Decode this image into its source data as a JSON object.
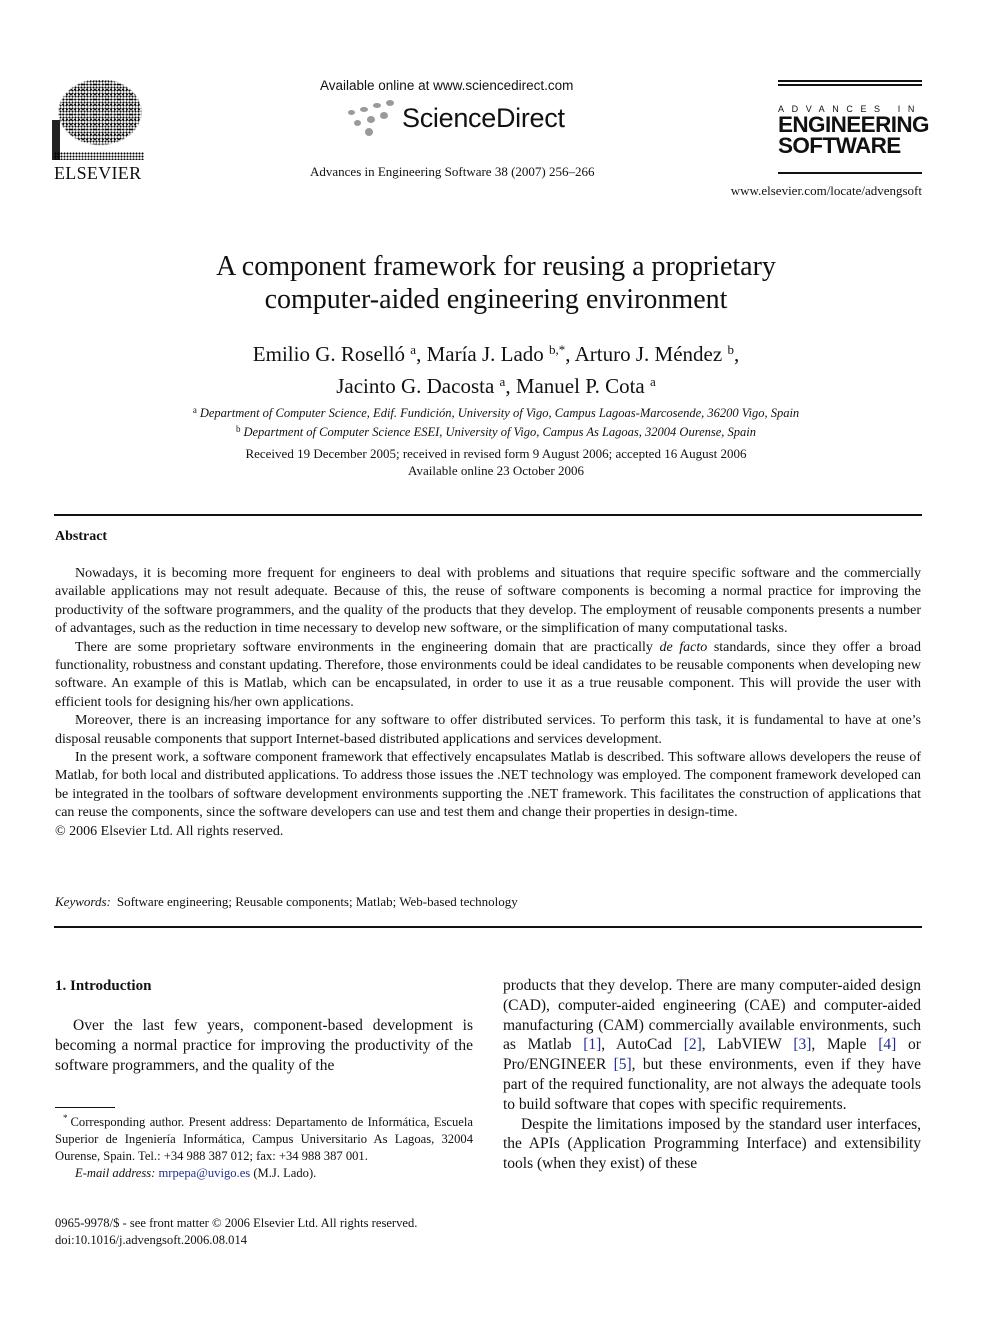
{
  "header": {
    "publisher_name": "ELSEVIER",
    "available_online": "Available online at www.sciencedirect.com",
    "sciencedirect_logo": "ScienceDirect",
    "journal_reference": "Advances in Engineering Software 38 (2007) 256–266",
    "journal_logo": {
      "small_line": "ADVANCES IN",
      "line1": "ENGINEERING",
      "line2": "SOFTWARE"
    },
    "journal_url": "www.elsevier.com/locate/advengsoft"
  },
  "article": {
    "title_line1": "A component framework for reusing a proprietary",
    "title_line2": "computer-aided engineering environment",
    "authors": [
      {
        "name": "Emilio G. Roselló",
        "affil": "a",
        "sep": ", "
      },
      {
        "name": "María J. Lado",
        "affil": "b,*",
        "sep": ", "
      },
      {
        "name": "Arturo J. Méndez",
        "affil": "b",
        "sep": ","
      },
      {
        "name": "Jacinto G. Dacosta",
        "affil": "a",
        "sep": ", "
      },
      {
        "name": "Manuel P. Cota",
        "affil": "a",
        "sep": ""
      }
    ],
    "affiliations": [
      {
        "mark": "a",
        "text": "Department of Computer Science, Edif. Fundición, University of Vigo, Campus Lagoas-Marcosende, 36200 Vigo, Spain"
      },
      {
        "mark": "b",
        "text": "Department of Computer Science ESEI, University of Vigo, Campus As Lagoas, 32004 Ourense, Spain"
      }
    ],
    "dates_line1": "Received 19 December 2005; received in revised form 9 August 2006; accepted 16 August 2006",
    "dates_line2": "Available online 23 October 2006"
  },
  "abstract": {
    "heading": "Abstract",
    "p1": "Nowadays, it is becoming more frequent for engineers to deal with problems and situations that require specific software and the commercially available applications may not result adequate. Because of this, the reuse of software components is becoming a normal practice for improving the productivity of the software programmers, and the quality of the products that they develop. The employment of reusable components presents a number of advantages, such as the reduction in time necessary to develop new software, or the simplification of many computational tasks.",
    "p2_before": "There are some proprietary software environments in the engineering domain that are practically ",
    "p2_italic": "de facto",
    "p2_after": " standards, since they offer a broad functionality, robustness and constant updating. Therefore, those environments could be ideal candidates to be reusable components when developing new software. An example of this is Matlab, which can be encapsulated, in order to use it as a true reusable component. This will provide the user with efficient tools for designing his/her own applications.",
    "p3": "Moreover, there is an increasing importance for any software to offer distributed services. To perform this task, it is fundamental to have at one’s disposal reusable components that support Internet-based distributed applications and services development.",
    "p4": "In the present work, a software component framework that effectively encapsulates Matlab is described. This software allows developers the reuse of Matlab, for both local and distributed applications. To address those issues the .NET technology was employed. The component framework developed can be integrated in the toolbars of software development environments supporting the .NET framework. This facilitates the construction of applications that can reuse the components, since the software developers can use and test them and change their properties in design-time.",
    "copyright": "© 2006 Elsevier Ltd. All rights reserved.",
    "keywords_label": "Keywords:",
    "keywords": "Software engineering; Reusable components; Matlab; Web-based technology"
  },
  "body": {
    "section_heading": "1. Introduction",
    "left_p1": "Over the last few years, component-based development is becoming a normal practice for improving the productivity of the software programmers, and the quality of the",
    "right_p1_a": "products that they develop. There are many computer-aided design (CAD), computer-aided engineering (CAE) and computer-aided manufacturing (CAM) commercially available environments, such as Matlab ",
    "refs": [
      "[1]",
      "[2]",
      "[3]",
      "[4]",
      "[5]"
    ],
    "right_p1_b": ", AutoCad ",
    "right_p1_c": ", LabVIEW ",
    "right_p1_d": ", Maple ",
    "right_p1_e": " or Pro/ENGINEER ",
    "right_p1_f": ", but these environments, even if they have part of the required functionality, are not always the adequate tools to build software that copes with specific requirements.",
    "right_p2": "Despite the limitations imposed by the standard user interfaces, the APIs (Application Programming Interface) and extensibility tools (when they exist) of these"
  },
  "footnote": {
    "mark": "*",
    "text": "Corresponding author. Present address: Departamento de Informática, Escuela Superior de Ingeniería Informática, Campus Universitario As Lagoas, 32004 Ourense, Spain. Tel.: +34 988 387 012; fax: +34 988 387 001.",
    "email_label": "E-mail address:",
    "email": "mrpepa@uvigo.es",
    "email_suffix": " (M.J. Lado)."
  },
  "front_matter": {
    "line1": "0965-9978/$ - see front matter  © 2006 Elsevier Ltd. All rights reserved.",
    "line2": "doi:10.1016/j.advengsoft.2006.08.014"
  },
  "colors": {
    "link": "#1f2f8f",
    "text": "#111111",
    "logo_gray": "#9a9a9a"
  }
}
